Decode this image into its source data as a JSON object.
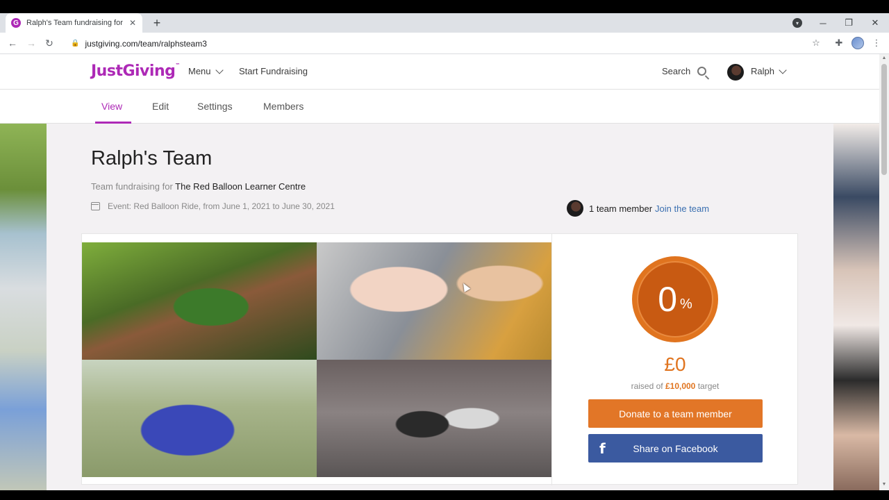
{
  "browser": {
    "tab_title": "Ralph's Team fundraising for The",
    "tab_favicon": "G",
    "url": "justgiving.com/team/ralphsteam3",
    "icons": {
      "back": "←",
      "forward": "→",
      "reload": "↻",
      "lock": "🔒",
      "star": "☆",
      "extensions": "✚",
      "menu": "⋮",
      "close": "✕",
      "new_tab": "+",
      "minimize": "─",
      "maximize": "❐",
      "window_close": "✕"
    }
  },
  "header": {
    "logo": "JustGiving",
    "logo_mark": "™",
    "menu_label": "Menu",
    "start_fundraising": "Start Fundraising",
    "search_label": "Search",
    "user_name": "Ralph"
  },
  "subnav": {
    "items": [
      "View",
      "Edit",
      "Settings",
      "Members"
    ],
    "active": "View"
  },
  "team": {
    "title": "Ralph's Team",
    "fundraising_prefix": "Team fundraising for",
    "charity": "The Red Balloon Learner Centre",
    "event": "Event: Red Balloon Ride, from June 1, 2021 to June 30, 2021",
    "member_count": "1 team member",
    "join_label": "Join the team"
  },
  "progress": {
    "percent": "0",
    "percent_sign": "%",
    "raised": "£0",
    "raised_prefix": "raised of",
    "target": "£10,000",
    "target_suffix": "target"
  },
  "actions": {
    "donate_label": "Donate to a team member",
    "share_label": "Share on Facebook",
    "facebook_icon": "f"
  },
  "colors": {
    "brand": "#ad29b6",
    "accent_orange": "#e27627",
    "facebook_blue": "#3b5aa0",
    "link_blue": "#3a6fb0"
  }
}
